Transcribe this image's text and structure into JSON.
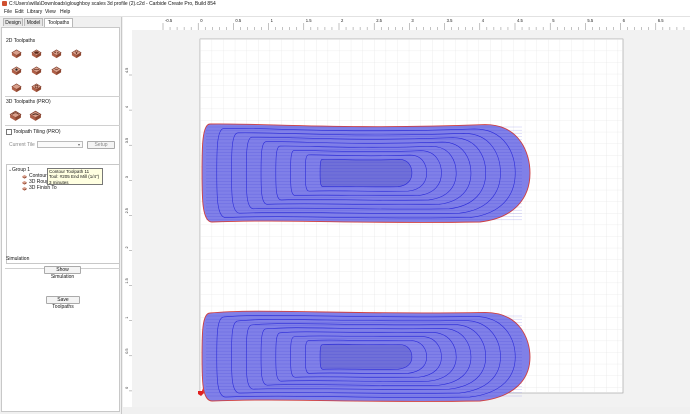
{
  "window": {
    "title": "C:\\Users\\willa\\Downloads\\gloughboy scales 3d profile (2).c2d - Carbide Create Pro, Build 854"
  },
  "menu": [
    "File",
    "Edit",
    "Library",
    "View",
    "Help"
  ],
  "tabs": [
    "Design",
    "Model",
    "Toolpaths"
  ],
  "toolpaths": {
    "section_2d": "2D Toolpaths",
    "section_3d": "3D Toolpaths (PRO)",
    "tiling_label": "Toolpath Tiling (PRO)",
    "current_tile_label": "Current Tile",
    "setup_label": "Setup",
    "tree": {
      "group": "Group 1",
      "items": [
        "Contour Toolpath 11 - 3 minutes",
        "3D Rough To",
        "3D Finish To"
      ]
    },
    "tooltip": [
      "Contour Toolpath 11",
      "Tool: #205 End Mill (1/4\")",
      "3 minutes"
    ],
    "simulation_label": "Simulation",
    "show_simulation": "Show Simulation",
    "save_toolpaths": "Save Toolpaths"
  },
  "ruler": {
    "x_labels": [
      "-0.5",
      "0",
      "0.5",
      "1",
      "1.5",
      "2",
      "2.5",
      "3",
      "3.5",
      "4",
      "4.5",
      "5",
      "5.5",
      "6",
      "6.5"
    ],
    "y_labels": [
      "4.5",
      "4",
      "3.5",
      "3",
      "2.5",
      "2",
      "1.5",
      "1",
      "0.5",
      "0"
    ]
  },
  "colors": {
    "toolpath": "#2a2ad8",
    "fill": "#8080e8",
    "outline": "#d04040",
    "origin": "#e02020",
    "grid": "#dedede",
    "grid_major": "#cfcfcf"
  }
}
